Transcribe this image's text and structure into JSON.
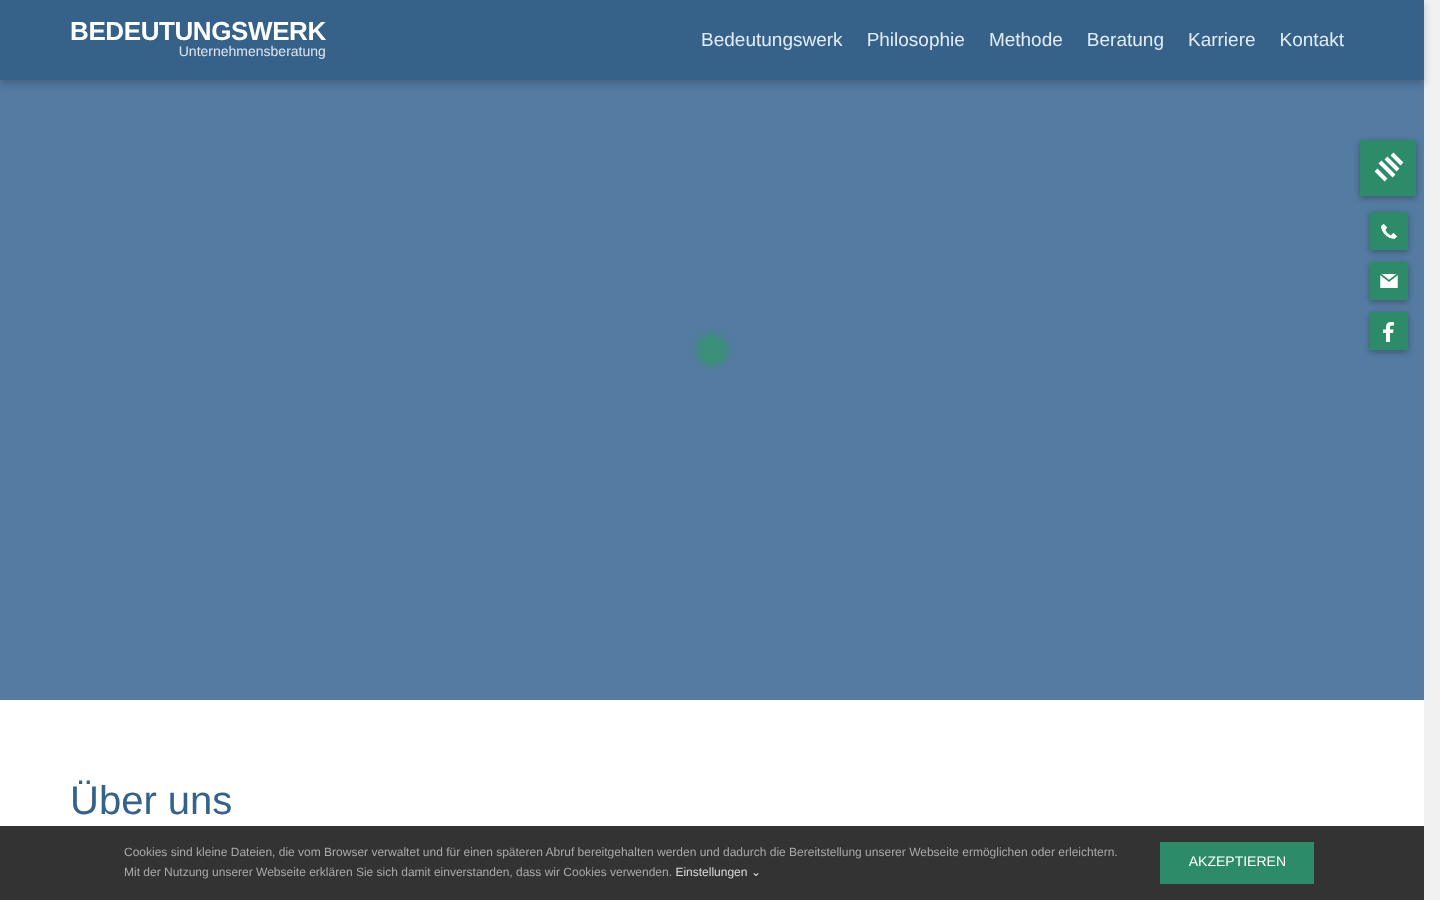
{
  "logo": {
    "name": "BEDEUTUNGSWERK",
    "tagline": "Unternehmensberatung"
  },
  "nav": [
    "Bedeutungswerk",
    "Philosophie",
    "Methode",
    "Beratung",
    "Karriere",
    "Kontakt"
  ],
  "side_buttons": [
    {
      "kind": "menu"
    },
    {
      "kind": "phone"
    },
    {
      "kind": "mail"
    },
    {
      "kind": "facebook"
    }
  ],
  "section": {
    "heading": "Über uns"
  },
  "cookie_bar": {
    "text": "Cookies sind kleine Dateien, die vom Browser verwaltet und für einen späteren Abruf bereitgehalten werden und dadurch die Bereitstellung unserer Webseite ermöglichen oder erleichtern. Mit der Nutzung unserer Webseite erklären Sie sich damit einverstanden, dass wir Cookies verwenden.",
    "settings_link": "Einstellungen ⌄",
    "button": "AKZEPTIEREN"
  }
}
